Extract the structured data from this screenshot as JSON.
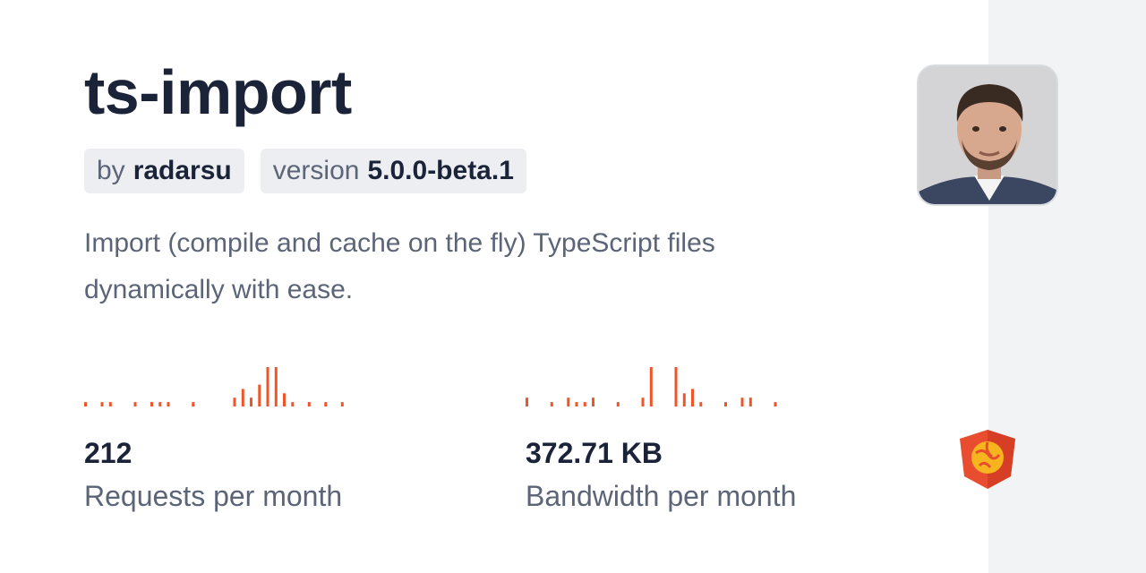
{
  "package": {
    "name": "ts-import",
    "author_label": "by",
    "author": "radarsu",
    "version_label": "version",
    "version": "5.0.0-beta.1",
    "description": "Import (compile and cache on the fly) TypeScript files dynamically with ease."
  },
  "stats": {
    "requests": {
      "value": "212",
      "label": "Requests per month"
    },
    "bandwidth": {
      "value": "372.71 KB",
      "label": "Bandwidth per month"
    }
  },
  "colors": {
    "accent": "#f0552a",
    "title": "#1a2338",
    "muted": "#5b6577",
    "chip_bg": "#eceef2",
    "side_bg": "#f2f3f5"
  },
  "icons": {
    "logo": "jsdelivr-logo-icon",
    "avatar": "author-avatar"
  },
  "chart_data": [
    {
      "type": "bar",
      "values": [
        1,
        0,
        1,
        1,
        0,
        0,
        1,
        0,
        1,
        1,
        1,
        0,
        0,
        1,
        0,
        0,
        0,
        0,
        2,
        4,
        2,
        5,
        9,
        9,
        3,
        1,
        0,
        1,
        0,
        1,
        0,
        1
      ],
      "ylim": [
        0,
        9
      ]
    },
    {
      "type": "bar",
      "values": [
        2,
        0,
        0,
        1,
        0,
        2,
        1,
        1,
        2,
        0,
        0,
        1,
        0,
        0,
        2,
        9,
        0,
        0,
        9,
        3,
        4,
        1,
        0,
        0,
        1,
        0,
        2,
        2,
        0,
        0,
        1,
        0
      ],
      "ylim": [
        0,
        9
      ]
    }
  ]
}
